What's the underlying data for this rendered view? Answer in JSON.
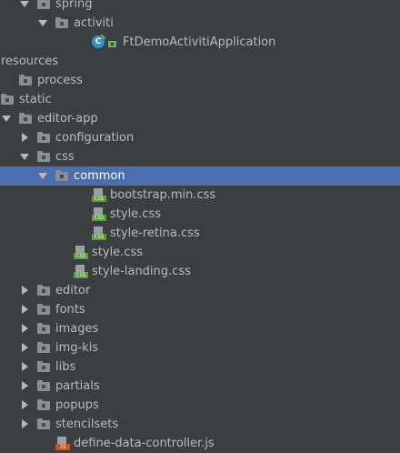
{
  "tree": {
    "rows": [
      {
        "label": "spring",
        "kind": "folder",
        "arrow": "down",
        "level": 5
      },
      {
        "label": "activiti",
        "kind": "folder",
        "arrow": "down",
        "level": 6
      },
      {
        "label": "FtDemoActivitiApplication",
        "kind": "spring-class",
        "arrow": "",
        "level": 8
      },
      {
        "label": "resources",
        "kind": "resources-folder",
        "arrow": "down",
        "level": 2
      },
      {
        "label": "process",
        "kind": "folder",
        "arrow": "",
        "level": 4
      },
      {
        "label": "static",
        "kind": "folder",
        "arrow": "down",
        "level": 3
      },
      {
        "label": "editor-app",
        "kind": "folder",
        "arrow": "down",
        "level": 4
      },
      {
        "label": "configuration",
        "kind": "folder",
        "arrow": "right",
        "level": 5
      },
      {
        "label": "css",
        "kind": "folder",
        "arrow": "down",
        "level": 5
      },
      {
        "label": "common",
        "kind": "folder",
        "arrow": "down",
        "level": 6,
        "selected": true
      },
      {
        "label": "bootstrap.min.css",
        "kind": "css-file",
        "arrow": "",
        "level": 8
      },
      {
        "label": "style.css",
        "kind": "css-file",
        "arrow": "",
        "level": 8
      },
      {
        "label": "style-retina.css",
        "kind": "css-file",
        "arrow": "",
        "level": 8
      },
      {
        "label": "style.css",
        "kind": "css-file",
        "arrow": "",
        "level": 7
      },
      {
        "label": "style-landing.css",
        "kind": "css-file",
        "arrow": "",
        "level": 7
      },
      {
        "label": "editor",
        "kind": "folder",
        "arrow": "right",
        "level": 5
      },
      {
        "label": "fonts",
        "kind": "folder",
        "arrow": "right",
        "level": 5
      },
      {
        "label": "images",
        "kind": "folder",
        "arrow": "right",
        "level": 5
      },
      {
        "label": "img-kis",
        "kind": "folder",
        "arrow": "right",
        "level": 5
      },
      {
        "label": "libs",
        "kind": "folder",
        "arrow": "right",
        "level": 5
      },
      {
        "label": "partials",
        "kind": "folder",
        "arrow": "right",
        "level": 5
      },
      {
        "label": "popups",
        "kind": "folder",
        "arrow": "right",
        "level": 5
      },
      {
        "label": "stencilsets",
        "kind": "folder",
        "arrow": "right",
        "level": 5
      },
      {
        "label": "define-data-controller.js",
        "kind": "js-file",
        "arrow": "",
        "level": 6
      }
    ]
  },
  "colors": {
    "background": "#3c3f41",
    "selection": "#4b6eaf",
    "text": "#bbbbbb",
    "selected_text": "#ffffff"
  },
  "icon_text": {
    "css_badge": "CSS",
    "js_badge": "JS",
    "class_badge": "C"
  }
}
